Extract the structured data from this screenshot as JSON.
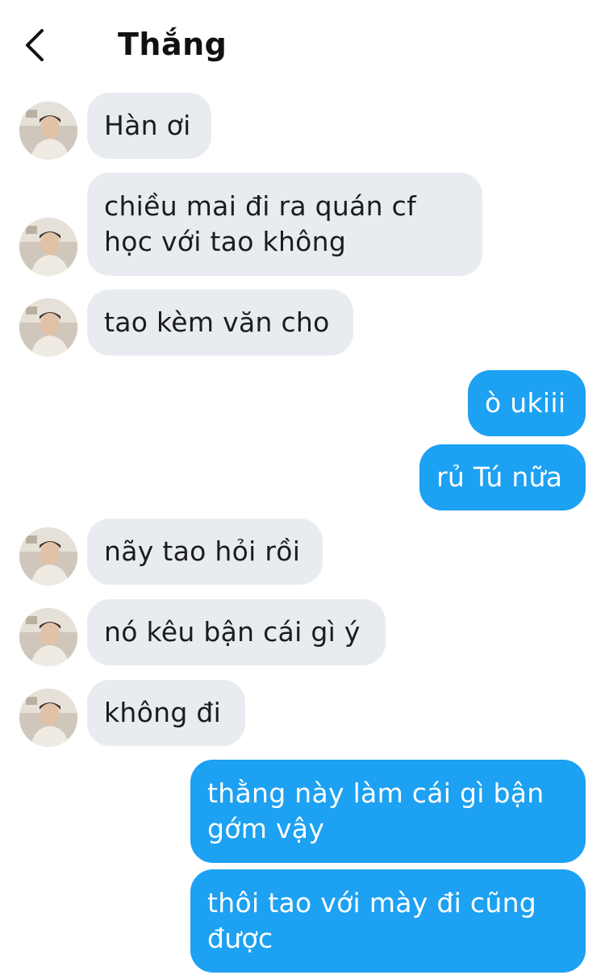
{
  "header": {
    "title": "Thắng"
  },
  "messages": [
    {
      "side": "in",
      "lines": [
        "Hàn ơi"
      ]
    },
    {
      "side": "in",
      "lines": [
        "chiều mai đi ra quán cf",
        "học với tao không"
      ]
    },
    {
      "side": "in",
      "lines": [
        "tao kèm văn cho"
      ]
    },
    {
      "side": "out",
      "lines": [
        "ò ukiii"
      ]
    },
    {
      "side": "out",
      "lines": [
        "rủ Tú nữa"
      ]
    },
    {
      "side": "in",
      "lines": [
        "nãy tao hỏi rồi"
      ]
    },
    {
      "side": "in",
      "lines": [
        "nó kêu bận cái gì ý"
      ]
    },
    {
      "side": "in",
      "lines": [
        "không đi"
      ]
    },
    {
      "side": "out",
      "lines": [
        "thằng này làm cái gì bận",
        "gớm vậy"
      ]
    },
    {
      "side": "out",
      "lines": [
        "thôi tao với mày đi cũng",
        "được"
      ]
    }
  ],
  "colors": {
    "outgoing_bubble": "#1da1f2",
    "incoming_bubble": "#e8ebef"
  },
  "icons": {
    "back": "chevron-left-icon",
    "avatar": "contact-avatar"
  }
}
